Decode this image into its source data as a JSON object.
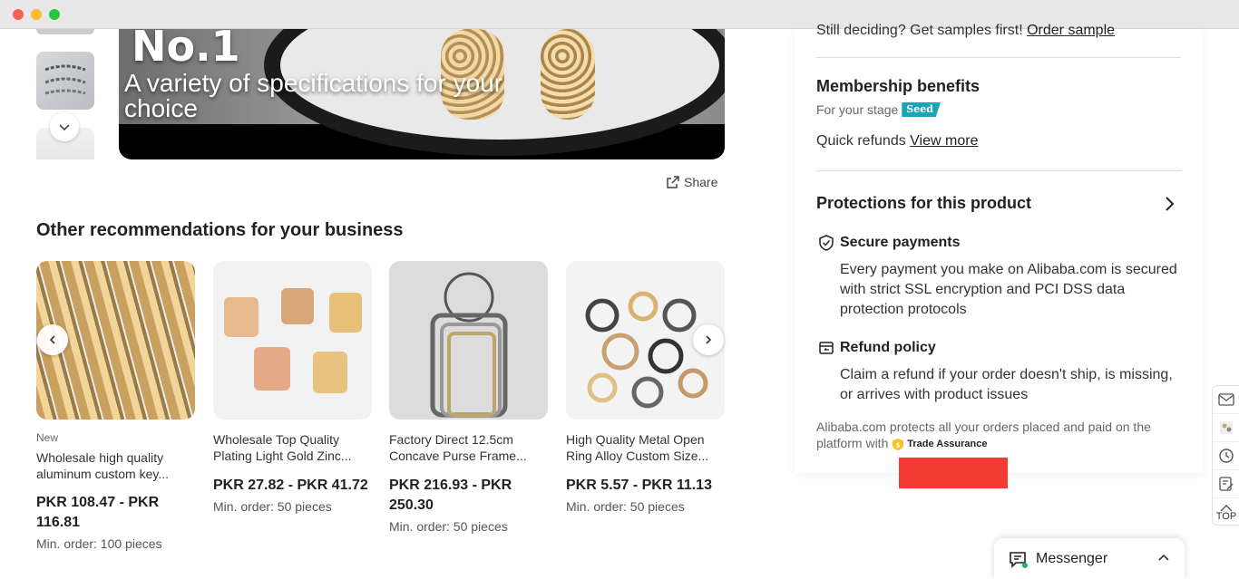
{
  "banner": {
    "headline": "No.1",
    "tagline": "A variety of specifications for your choice"
  },
  "share": {
    "label": "Share"
  },
  "recommendations": {
    "title": "Other recommendations for your business",
    "items": [
      {
        "badge": "New",
        "name": "Wholesale high quality aluminum custom key...",
        "price": "PKR 108.47 - PKR 116.81",
        "moq": "Min. order: 100 pieces"
      },
      {
        "badge": "",
        "name": "Wholesale Top Quality Plating Light Gold Zinc...",
        "price": "PKR 27.82 - PKR 41.72",
        "moq": "Min. order: 50 pieces"
      },
      {
        "badge": "",
        "name": "Factory Direct 12.5cm Concave Purse Frame...",
        "price": "PKR 216.93 - PKR 250.30",
        "moq": "Min. order: 50 pieces"
      },
      {
        "badge": "",
        "name": "High Quality Metal Open Ring Alloy Custom Size...",
        "price": "PKR 5.57 - PKR 11.13",
        "moq": "Min. order: 50 pieces"
      }
    ]
  },
  "panel": {
    "sample_text": "Still deciding? Get samples first!",
    "sample_link": "Order sample",
    "membership_title": "Membership benefits",
    "stage_label": "For your stage",
    "stage_badge": "Seed",
    "refunds_text": "Quick refunds",
    "refunds_link": "View more",
    "protections_title": "Protections for this product",
    "secure_title": "Secure payments",
    "secure_body": "Every payment you make on Alibaba.com is secured with strict SSL encryption and PCI DSS data protection protocols",
    "refund_title": "Refund policy",
    "refund_body": "Claim a refund if your order doesn't ship, is missing, or arrives with product issues",
    "footer_text": "Alibaba.com protects all your orders placed and paid on the platform with",
    "trade_assurance": "Trade Assurance"
  },
  "sidebar": {
    "top_label": "TOP"
  },
  "messenger": {
    "label": "Messenger"
  },
  "colors": {
    "seed_badge": "#1aa6b7",
    "red_block": "#f43c35",
    "online_dot": "#1bb55c"
  }
}
